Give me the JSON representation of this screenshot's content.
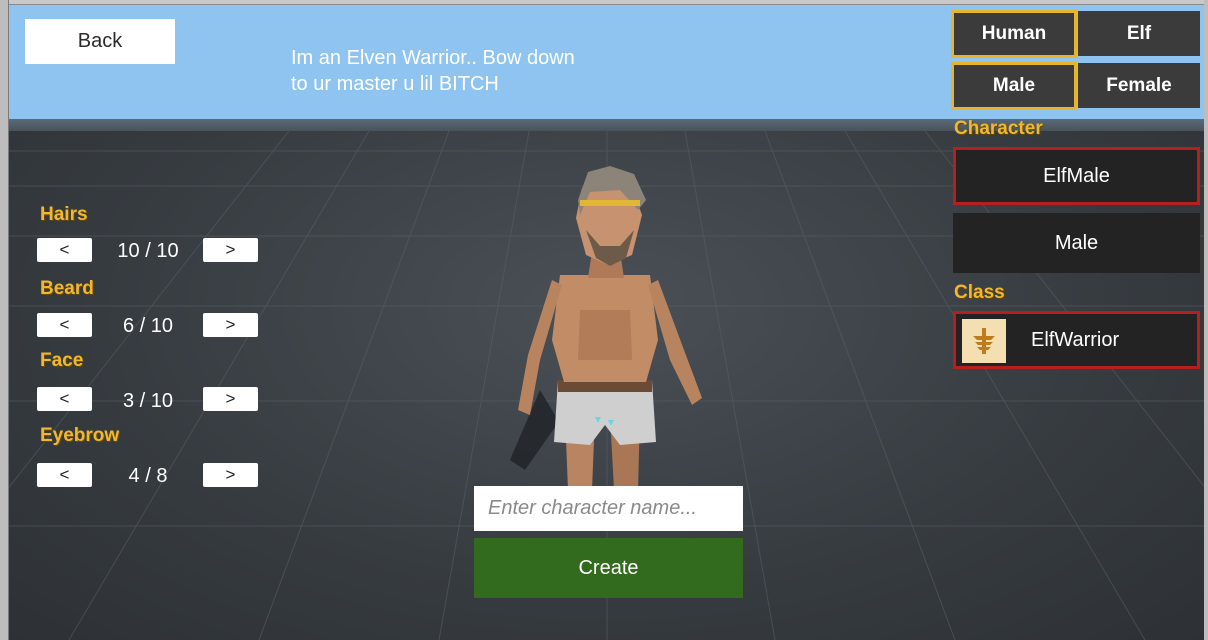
{
  "header": {
    "back_label": "Back",
    "flavor_text": "Im an Elven Warrior.. Bow down to ur master u lil BITCH"
  },
  "race": {
    "options": [
      "Human",
      "Elf"
    ],
    "selected": "Human"
  },
  "gender": {
    "options": [
      "Male",
      "Female"
    ],
    "selected": "Male"
  },
  "character_panel": {
    "label": "Character",
    "model_name": "ElfMale",
    "gender_text": "Male"
  },
  "class_panel": {
    "label": "Class",
    "class_name": "ElfWarrior"
  },
  "customization": [
    {
      "label": "Hairs",
      "value": "10 / 10"
    },
    {
      "label": "Beard",
      "value": "6 / 10"
    },
    {
      "label": "Face",
      "value": "3 / 10"
    },
    {
      "label": "Eyebrow",
      "value": "4 / 8"
    }
  ],
  "arrows": {
    "prev": "<",
    "next": ">"
  },
  "name_input": {
    "placeholder": "Enter character name...",
    "value": ""
  },
  "create_label": "Create",
  "colors": {
    "sky": "#8fc4f0",
    "accent_gold": "#f0b830",
    "selected_border": "#e6b52e",
    "red_border": "#b51f1f",
    "create_green": "#336b1e"
  }
}
